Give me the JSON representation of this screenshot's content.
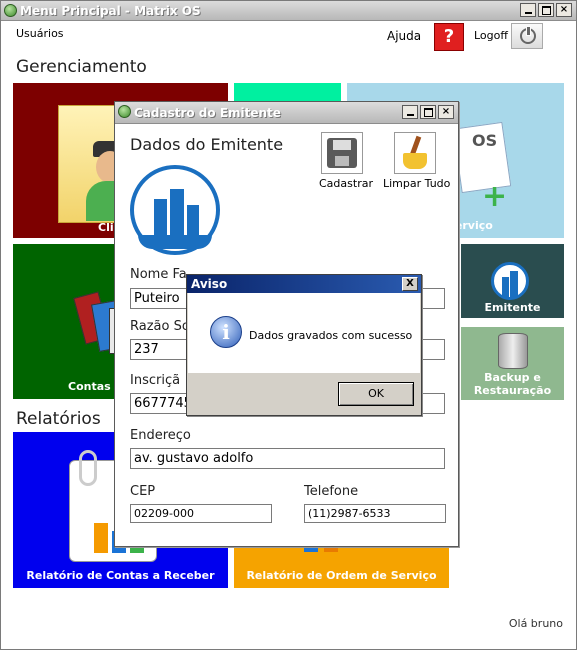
{
  "window": {
    "title": "Menu Principal - Matrix OS"
  },
  "menubar": {
    "users": "Usuários",
    "help": "Ajuda",
    "help_glyph": "?",
    "logoff": "Logoff"
  },
  "sections": {
    "management": "Gerenciamento",
    "reports": "Relatórios"
  },
  "tiles": {
    "clientes_partial": "Cli",
    "servico_partial": "Serviço",
    "emitente": "Emitente",
    "contas_partial": "Contas",
    "backup_line1": "Backup e",
    "backup_line2": "Restauração",
    "rel_contas": "Relatório de Contas a Receber",
    "rel_os": "Relatório de Ordem de Serviço"
  },
  "greeting": "Olá bruno",
  "emitente_dialog": {
    "title": "Cadastro do Emitente",
    "heading": "Dados do Emitente",
    "save_label": "Cadastrar",
    "clear_label": "Limpar Tudo",
    "fantasy_label": "Nome Fa",
    "fantasy_value": "Puteiro",
    "razao_label": "Razão So",
    "razao_value": "237",
    "inscricao_label": "Inscriçã",
    "inscricao_value": "6677745",
    "endereco_label": "Endereço",
    "endereco_value": "av. gustavo adolfo",
    "cep_label": "CEP",
    "cep_value": "02209-000",
    "telefone_label": "Telefone",
    "telefone_value": "(11)2987-6533"
  },
  "aviso_dialog": {
    "title": "Aviso",
    "close_glyph": "X",
    "message": "Dados gravados com sucesso",
    "ok_label": "OK",
    "info_glyph": "i"
  },
  "colors": {
    "tile_red": "#7d0000",
    "tile_teal": "#00f0a0",
    "tile_lightblue": "#a8d8ea",
    "tile_green": "#006400",
    "tile_dark_teal": "#2a4d4f",
    "tile_grey_green": "#8fb88f",
    "tile_blue": "#0000ee",
    "tile_orange": "#f5a300"
  }
}
